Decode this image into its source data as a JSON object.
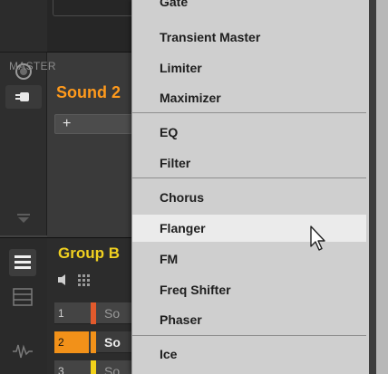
{
  "background": {
    "master_label": "MASTER",
    "sound_label": "Sound 2",
    "add_slot_label": "+",
    "group_label": "Group B",
    "sounds": [
      {
        "num": "1",
        "name": "So",
        "color": "#e25a2c"
      },
      {
        "num": "2",
        "name": "So",
        "color": "#f29119"
      },
      {
        "num": "3",
        "name": "So",
        "color": "#f2d11a"
      }
    ]
  },
  "menu": {
    "items": [
      {
        "label": "Gate"
      },
      {
        "label": "Transient Master"
      },
      {
        "label": "Limiter"
      },
      {
        "label": "Maximizer"
      },
      {
        "label": "EQ"
      },
      {
        "label": "Filter"
      },
      {
        "label": "Chorus"
      },
      {
        "label": "Flanger",
        "hovered": true
      },
      {
        "label": "FM"
      },
      {
        "label": "Freq Shifter"
      },
      {
        "label": "Phaser"
      },
      {
        "label": "Ice"
      }
    ]
  },
  "colors": {
    "accent_orange": "#ff9a1c",
    "group_yellow": "#f0d020",
    "menu_bg": "#cfcfcf",
    "menu_hover": "#ebebeb"
  },
  "icons": [
    "knob-icon",
    "plug-icon",
    "scroll-down-icon",
    "list-icon",
    "mixer-icon",
    "waveform-icon",
    "speaker-icon",
    "grid-icon",
    "mouse-cursor-icon"
  ]
}
